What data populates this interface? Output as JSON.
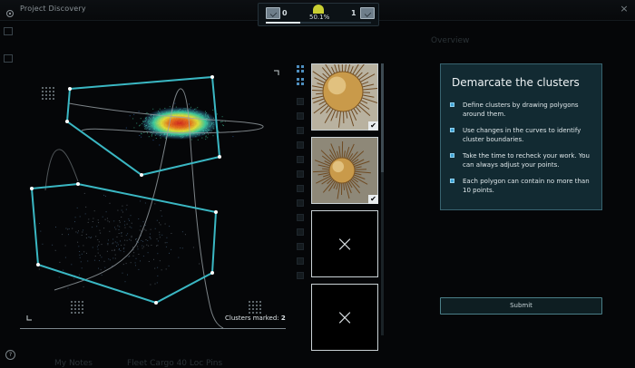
{
  "window": {
    "app_title": "Project Discovery",
    "close_glyph": "×",
    "logo_icon": "eve-logo-icon",
    "help_glyph": "?"
  },
  "score": {
    "left_count": "0",
    "accuracy": "50.1%",
    "right_count": "1",
    "progress_fraction": 0.33
  },
  "plot": {
    "clusters_marked_label": "Clusters marked:",
    "clusters_marked_count": "2",
    "polygon_color": "#3ab7c3",
    "density_colors": [
      "#3a7fd8",
      "#40d0a0",
      "#e6e23a",
      "#e8731d",
      "#d6261f"
    ]
  },
  "thumbnails": [
    {
      "state": "checked",
      "check_glyph": "✔"
    },
    {
      "state": "checked",
      "check_glyph": "✔"
    },
    {
      "state": "empty",
      "x_glyph": "×"
    },
    {
      "state": "empty",
      "x_glyph": "×"
    }
  ],
  "panel": {
    "title": "Demarcate the clusters",
    "bullets": [
      "Define clusters by drawing polygons around them.",
      "Use changes in the curves to identify cluster boundaries.",
      "Take the time to recheck your work. You can always adjust your points.",
      "Each polygon can contain no more than 10 points."
    ],
    "accent_color": "#3fa4d6"
  },
  "submit": {
    "label": "Submit"
  },
  "background_ghost_text": {
    "t1": "Overview",
    "t2": "My Notes",
    "t3": "Fleet Cargo 40 Loc Pins"
  }
}
